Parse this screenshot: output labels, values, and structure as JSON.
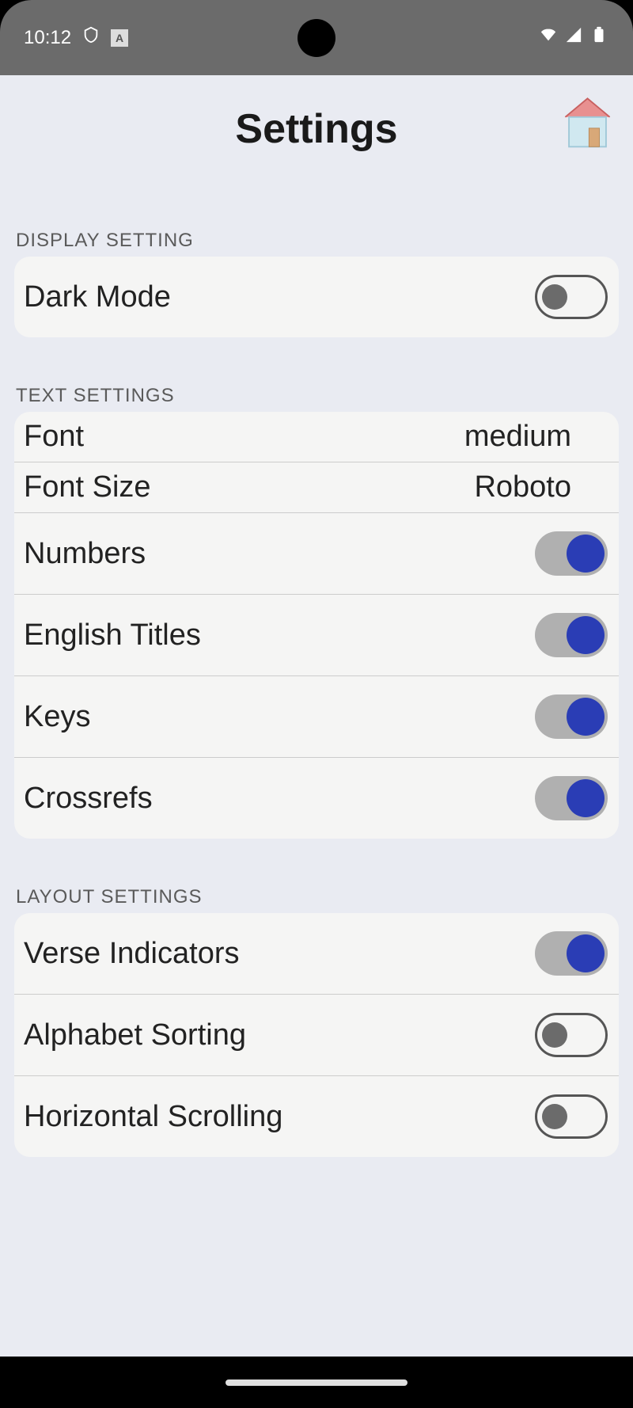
{
  "status": {
    "time": "10:12",
    "a_box": "A"
  },
  "header": {
    "title": "Settings"
  },
  "sections": {
    "display": {
      "title": "DISPLAY SETTING",
      "dark_mode": {
        "label": "Dark Mode",
        "on": false
      }
    },
    "text": {
      "title": "TEXT SETTINGS",
      "font": {
        "label": "Font",
        "value": "medium"
      },
      "font_size": {
        "label": "Font Size",
        "value": "Roboto"
      },
      "numbers": {
        "label": "Numbers",
        "on": true
      },
      "english_titles": {
        "label": "English Titles",
        "on": true
      },
      "keys": {
        "label": "Keys",
        "on": true
      },
      "crossrefs": {
        "label": "Crossrefs",
        "on": true
      }
    },
    "layout": {
      "title": "LAYOUT SETTINGS",
      "verse_indicators": {
        "label": "Verse Indicators",
        "on": true
      },
      "alphabet_sorting": {
        "label": "Alphabet Sorting",
        "on": false
      },
      "horizontal_scrolling": {
        "label": "Horizontal Scrolling",
        "on": false
      }
    }
  },
  "icons": {
    "home": "home-icon",
    "shield": "shield-icon",
    "wifi": "wifi-icon",
    "signal": "signal-icon",
    "battery": "battery-icon"
  }
}
